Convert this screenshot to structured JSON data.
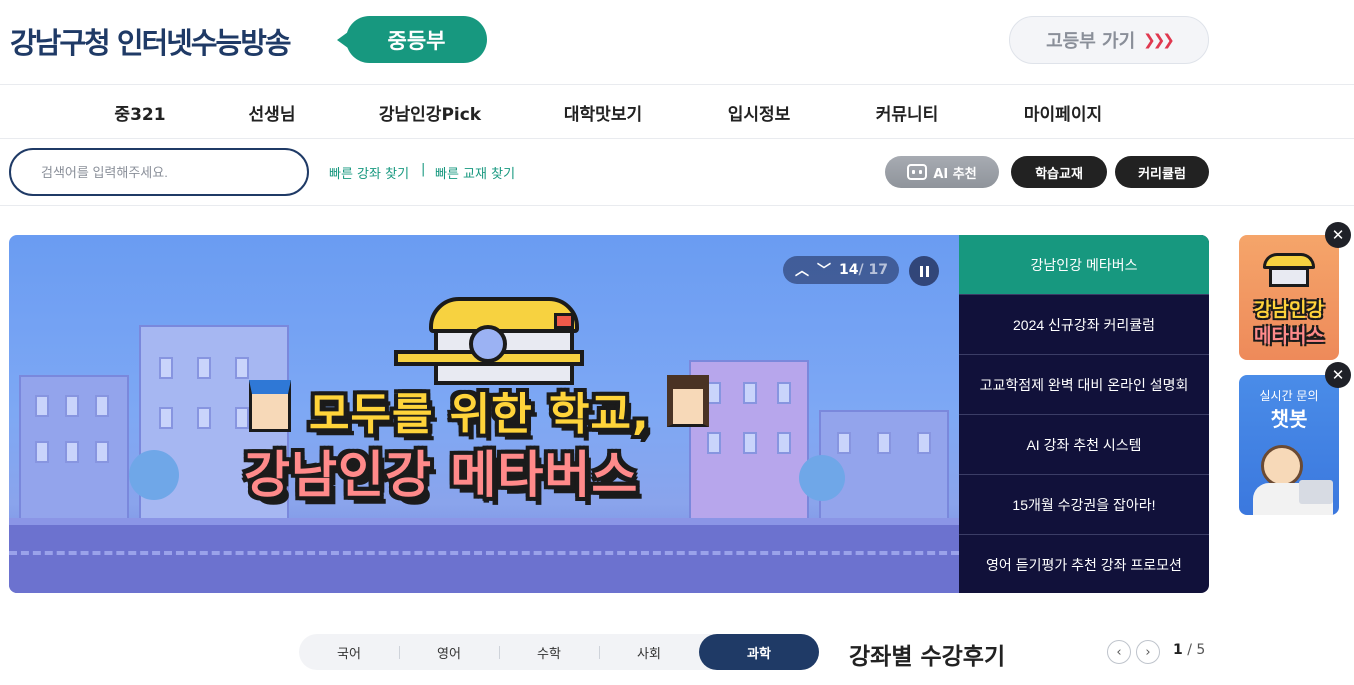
{
  "header": {
    "logo": "강남구청 인터넷수능방송",
    "level": "중등부",
    "goto_high": "고등부 가기",
    "goto_high_icon": "triple-chevron-right-icon"
  },
  "nav": {
    "items": [
      "중321",
      "선생님",
      "강남인강Pick",
      "대학맛보기",
      "입시정보",
      "커뮤니티",
      "마이페이지"
    ]
  },
  "search": {
    "placeholder": "검색어를 입력해주세요.",
    "quick_lecture": "빠른 강좌 찾기",
    "separator": "|",
    "quick_book": "빠른 교재 찾기"
  },
  "actions": {
    "ai": "AI 추천",
    "books": "학습교재",
    "curriculum": "커리큘럼"
  },
  "banner": {
    "line1": "모두를 위한 학교,",
    "line2": "강남인강 메타버스",
    "current": "14",
    "total": "/ 17",
    "menu": [
      "강남인강 메타버스",
      "2024 신규강좌 커리큘럼",
      "고교학점제 완벽 대비 온라인 설명회",
      "AI 강좌 추천 시스템",
      "15개월 수강권을 잡아라!",
      "영어 듣기평가 추천 강좌 프로모션"
    ],
    "active_index": 0
  },
  "floating": {
    "metaverse_line1": "강남인강",
    "metaverse_line2": "메타버스",
    "chatbot_small": "실시간 문의",
    "chatbot_big": "챗봇"
  },
  "subjects": {
    "tabs": [
      "국어",
      "영어",
      "수학",
      "사회",
      "과학"
    ],
    "active": "과학"
  },
  "reviews": {
    "title": "강좌별 수강후기",
    "page": "1",
    "total": "/ 5"
  },
  "colors": {
    "brand_navy": "#1f3a66",
    "brand_green": "#17987f",
    "banner_menu_bg": "#11113a"
  }
}
